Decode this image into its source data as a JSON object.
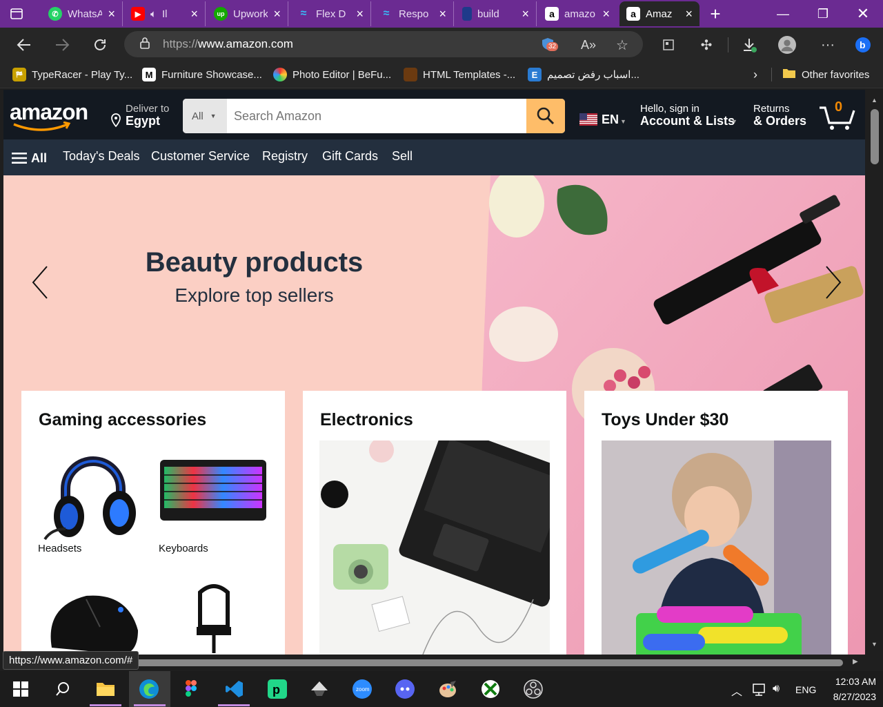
{
  "browser": {
    "tabs": [
      {
        "title": "WhatsApp",
        "icon": "whatsapp-icon",
        "color": "#25d366"
      },
      {
        "title": "Il",
        "icon": "youtube-icon",
        "color": "#ff0000"
      },
      {
        "title": "Upwork",
        "icon": "upwork-icon",
        "color": "#14a800"
      },
      {
        "title": "Flex D",
        "icon": "tailwind-icon",
        "color": "#38bdf8"
      },
      {
        "title": "Respo",
        "icon": "tailwind-icon",
        "color": "#38bdf8"
      },
      {
        "title": "build",
        "icon": "build-icon",
        "color": "#1e3a8a"
      },
      {
        "title": "amazo",
        "icon": "amazon-icon",
        "color": "#000000"
      },
      {
        "title": "Amaz",
        "icon": "amazon-icon",
        "color": "#ffffff"
      }
    ],
    "url_scheme": "https://",
    "url_host": "www.amazon.com",
    "tracker_count": "32",
    "favorites": [
      {
        "label": "TypeRacer - Play Ty...",
        "icon": "typeracer-icon"
      },
      {
        "label": "Furniture Showcase...",
        "icon": "m-icon"
      },
      {
        "label": "Photo Editor | BeFu...",
        "icon": "befunky-icon"
      },
      {
        "label": "HTML Templates -...",
        "icon": "templates-icon"
      },
      {
        "label": "اسباب رفض تصميم...",
        "icon": "e-icon"
      }
    ],
    "other_favorites": "Other favorites",
    "status_url": "https://www.amazon.com/#"
  },
  "amazon": {
    "logo": "amazon",
    "deliver_to": "Deliver to",
    "location": "Egypt",
    "search_category": "All",
    "search_placeholder": "Search Amazon",
    "language": "EN",
    "hello": "Hello, sign in",
    "account": "Account & Lists",
    "returns": "Returns",
    "orders": "& Orders",
    "cart_count": "0",
    "nav": {
      "all": "All",
      "links": [
        "Today's Deals",
        "Customer Service",
        "Registry",
        "Gift Cards",
        "Sell"
      ]
    },
    "hero": {
      "title": "Beauty products",
      "subtitle": "Explore top sellers"
    },
    "cards": {
      "gaming": {
        "title": "Gaming accessories",
        "items": [
          "Headsets",
          "Keyboards"
        ]
      },
      "electronics": {
        "title": "Electronics"
      },
      "toys": {
        "title": "Toys Under $30"
      }
    }
  },
  "taskbar": {
    "time": "12:03 AM",
    "date": "8/27/2023",
    "lang": "ENG"
  },
  "colors": {
    "tabbar": "#6b2b92",
    "amazon_header": "#131921",
    "amazon_nav": "#232f3e",
    "search_button": "#febd69",
    "cart_count": "#f08804"
  }
}
